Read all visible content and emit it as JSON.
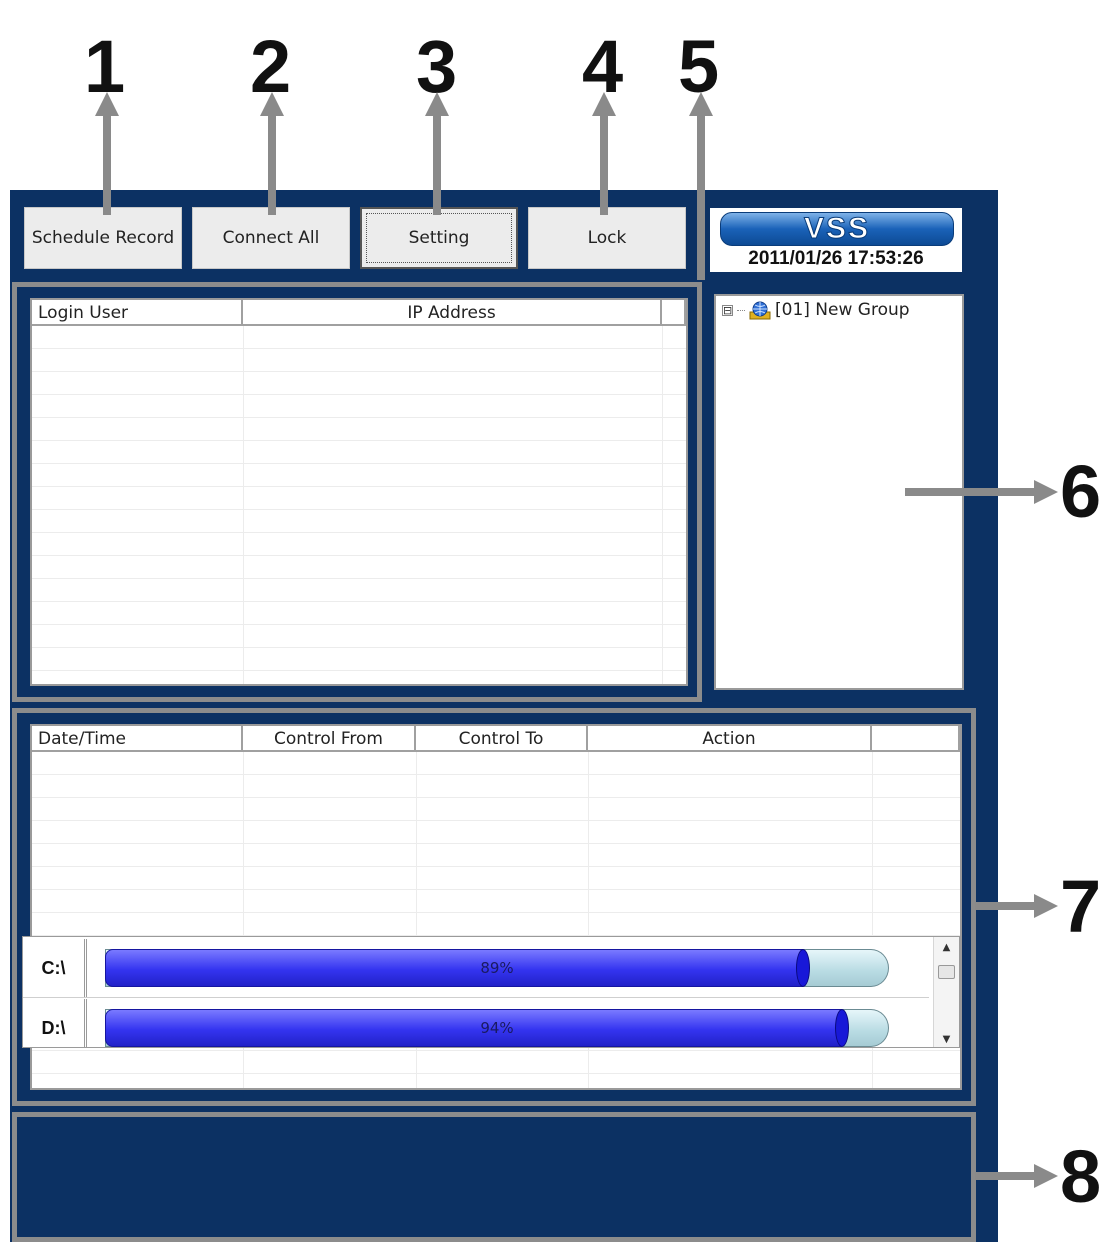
{
  "callouts": [
    "1",
    "2",
    "3",
    "4",
    "5",
    "6",
    "7",
    "8"
  ],
  "toolbar": {
    "schedule_record": "Schedule Record",
    "connect_all": "Connect All",
    "setting": "Setting",
    "lock": "Lock"
  },
  "logo": {
    "brand": "VSS",
    "datetime": "2011/01/26 17:53:26"
  },
  "user_list": {
    "columns": [
      "Login User",
      "IP Address"
    ]
  },
  "device_tree": {
    "items": [
      {
        "label": "[01] New Group",
        "expander": "⊟"
      }
    ]
  },
  "event_log": {
    "columns": [
      "Date/Time",
      "Control From",
      "Control To",
      "Action"
    ]
  },
  "disk_usage": [
    {
      "drive": "C:\\",
      "percent_label": "89%",
      "fraction": 0.89
    },
    {
      "drive": "D:\\",
      "percent_label": "94%",
      "fraction": 0.94
    }
  ],
  "icons": {
    "expander": "minus-box-icon",
    "group": "globe-group-icon",
    "scroll_up": "▲",
    "scroll_down": "▼"
  },
  "colors": {
    "app_background": "#0c3163",
    "callout_frame": "#8c8c8c",
    "bar_fill": "#3434f0",
    "bar_track": "#b8dbe3"
  }
}
